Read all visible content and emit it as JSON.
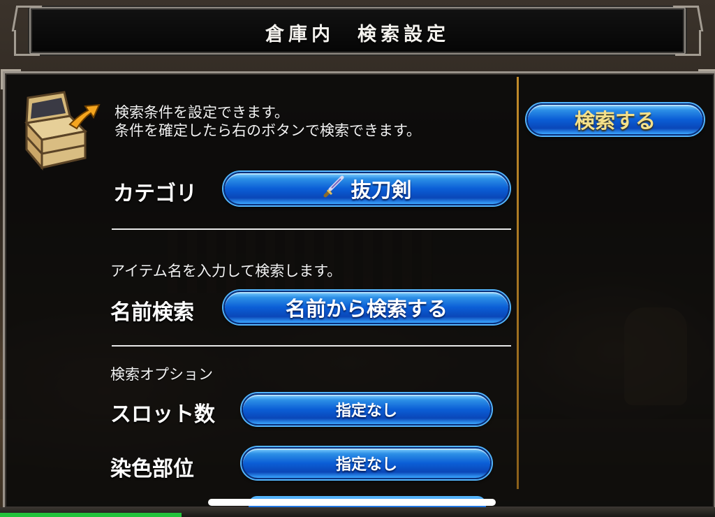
{
  "header": {
    "title": "倉庫内　検索設定"
  },
  "intro": {
    "line1": "検索条件を設定できます。",
    "line2": "条件を確定したら右のボタンで検索できます。",
    "icon": "treasure-chest-icon"
  },
  "search_button": {
    "label": "検索する"
  },
  "category": {
    "label": "カテゴリ",
    "value": "抜刀剣",
    "icon": "sword-icon"
  },
  "name_search": {
    "description": "アイテム名を入力して検索します。",
    "label": "名前検索",
    "button": "名前から検索する"
  },
  "options": {
    "heading": "検索オプション",
    "slots": {
      "label": "スロット数",
      "value": "指定なし"
    },
    "dye": {
      "label": "染色部位",
      "value": "指定なし"
    }
  },
  "colors": {
    "button_blue": "#0b5ed6",
    "search_text_gold": "#f4e08a",
    "divider_gold": "#c08a2a"
  }
}
